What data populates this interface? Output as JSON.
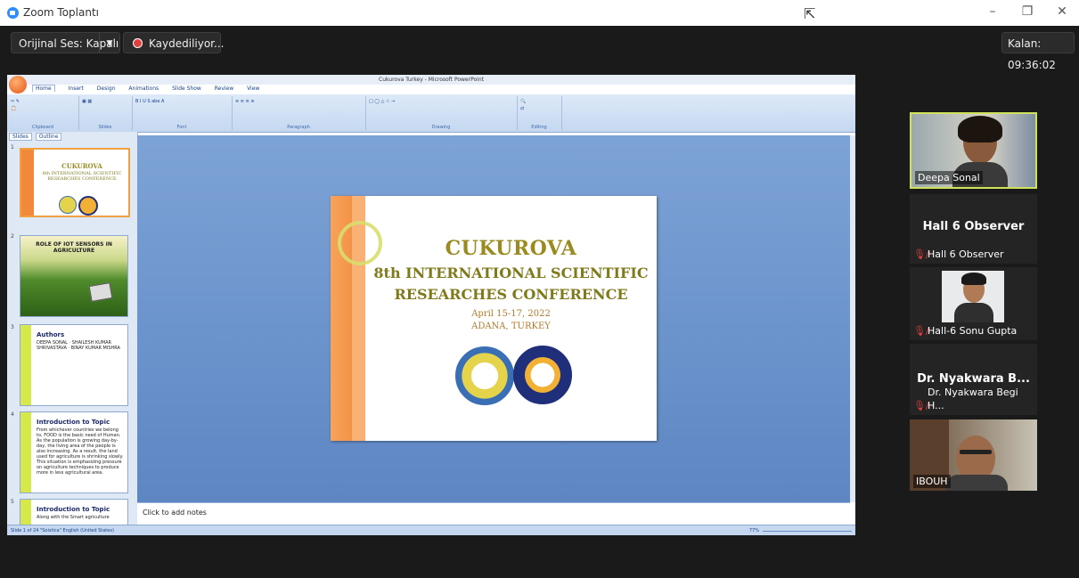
{
  "window": {
    "title": "Zoom Toplantı"
  },
  "meeting_bar": {
    "audio_label": "Orijinal Ses: Kapalı",
    "recording_label": "Kaydediliyor...",
    "timer_label": "Kalan: 09:36:02"
  },
  "powerpoint": {
    "title": "Cukurova Turkey - Microsoft PowerPoint",
    "tabs": [
      "Home",
      "Insert",
      "Design",
      "Animations",
      "Slide Show",
      "Review",
      "View"
    ],
    "ribbon_groups": [
      "Clipboard",
      "Slides",
      "Font",
      "Paragraph",
      "Drawing",
      "Editing"
    ],
    "pane_tabs": [
      "Slides",
      "Outline"
    ],
    "notes_placeholder": "Click to add notes",
    "status_text": "Slide 1 of 24   \"Soistica\"   English (United States)",
    "zoom": "77%",
    "thumbnails": [
      {
        "num": "1",
        "heading": "CUKUROVA",
        "text": "8th INTERNATIONAL SCIENTIFIC RESEARCHES CONFERENCE"
      },
      {
        "num": "2",
        "heading": "ROLE OF IOT SENSORS IN AGRICULTURE",
        "text": ""
      },
      {
        "num": "3",
        "heading": "Authors",
        "text": "DEEPA SONAL · SHAILESH KUMAR SHRIVASTAVA · BINAY KUMAR MISHRA"
      },
      {
        "num": "4",
        "heading": "Introduction to Topic",
        "text": "From whichever countries we belong to, FOOD is the basic need of Human. As the population is growing day-by-day, the living area of the people is also increasing. As a result, the land used for agriculture is shrinking slowly. This situation is emphasizing pressure on agriculture techniques to produce more in less agricultural area."
      },
      {
        "num": "5",
        "heading": "Introduction to Topic",
        "text": "Along with the Smart agriculture"
      }
    ],
    "slide": {
      "line1": "CUKUROVA",
      "line2": "8th INTERNATIONAL SCIENTIFIC",
      "line3": "RESEARCHES CONFERENCE",
      "line4": "April 15-17, 2022",
      "line5": "ADANA, TURKEY"
    }
  },
  "participants": [
    {
      "name": "Deepa Sonal",
      "type": "video",
      "muted": false
    },
    {
      "display": "Hall 6 Observer",
      "name": "Hall 6 Observer",
      "type": "avatar",
      "muted": true
    },
    {
      "name": "Hall-6 Sonu Gupta",
      "type": "video",
      "muted": true
    },
    {
      "display": "Dr. Nyakwara B...",
      "name": "Dr. Nyakwara Begi H...",
      "type": "avatar",
      "muted": true
    },
    {
      "name": "IBOUH",
      "type": "video",
      "muted": false
    }
  ]
}
